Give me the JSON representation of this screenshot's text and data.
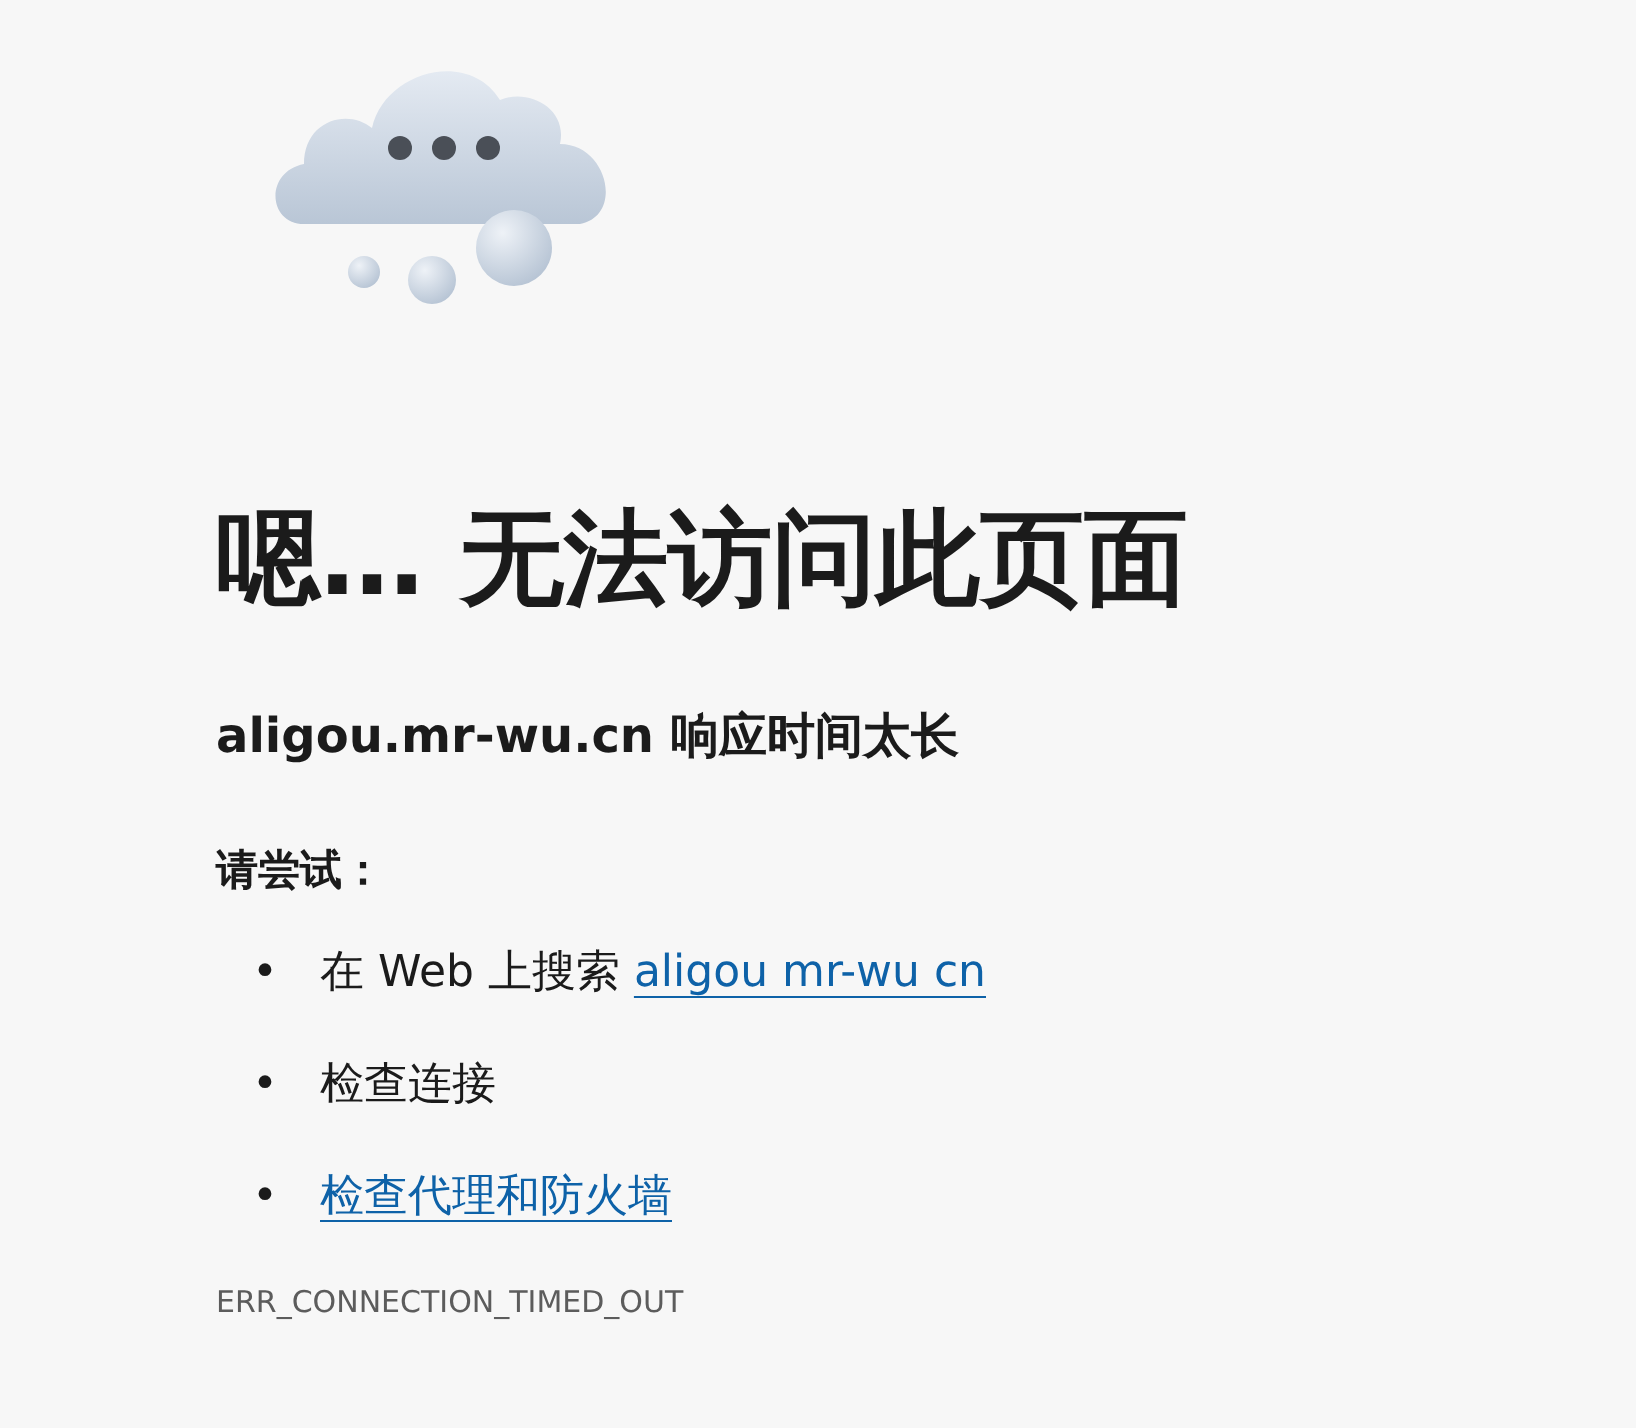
{
  "heading": "嗯… 无法访问此页面",
  "subtitle": "aligou.mr-wu.cn 响应时间太长",
  "try_label": "请尝试：",
  "suggestions": [
    {
      "bullet": "•",
      "text": "在 Web 上搜索",
      "link": "aligou mr-wu cn"
    },
    {
      "bullet": "•",
      "text": "检查连接"
    },
    {
      "bullet": "•",
      "link": "检查代理和防火墙"
    }
  ],
  "error_code": "ERR_CONNECTION_TIMED_OUT"
}
